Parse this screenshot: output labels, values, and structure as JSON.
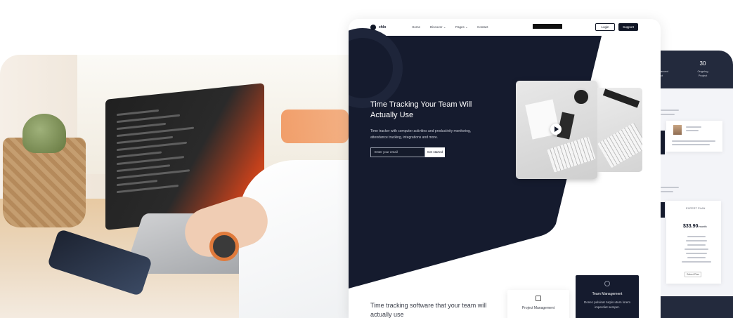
{
  "nav": {
    "logo_text": "chlo",
    "links": [
      "Home",
      "Discover ⌄",
      "Pages ⌄",
      "Contact"
    ],
    "login_label": "Login",
    "support_label": "Support"
  },
  "hero": {
    "title": "Time Tracking Your Team Will Actually Use",
    "description": "Time tracker with computer activities and productivity monitoring, attendance tracking, integrations and more.",
    "email_placeholder": "Enter your email",
    "cta_label": "Get started"
  },
  "section": {
    "subtitle": "Time tracking software that your team will actually use"
  },
  "cards": {
    "project_management": {
      "title": "Project Management"
    },
    "team_management": {
      "title": "Team Management",
      "text": "Donec pulvinar turpis utum lorem imperdiet semper."
    }
  },
  "right_panel": {
    "stat_value": "30",
    "stat_label": "Ongoing Project",
    "stat_fragment": "anced\nct",
    "price": "$33.90",
    "price_unit": "/month"
  },
  "colors": {
    "navy": "#101626",
    "hero_bg": "#151b2e",
    "accent_orange": "#e85a1e"
  }
}
